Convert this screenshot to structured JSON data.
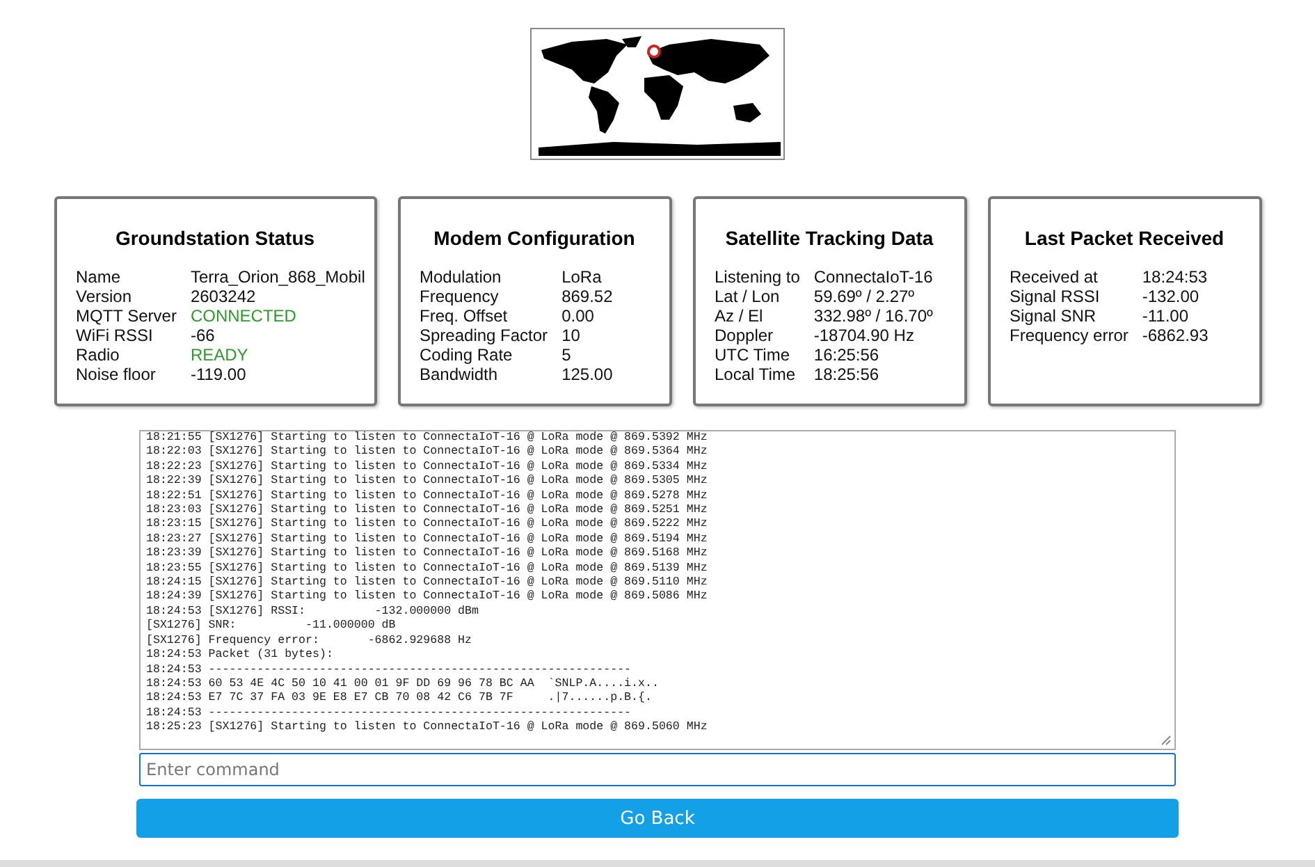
{
  "cards": [
    {
      "title": "Groundstation Status",
      "rows": [
        {
          "label": "Name",
          "value": "Terra_Orion_868_Mobil"
        },
        {
          "label": "Version",
          "value": "2603242"
        },
        {
          "label": "MQTT Server",
          "value": "CONNECTED",
          "color": "#2e9a2e"
        },
        {
          "label": "WiFi RSSI",
          "value": "-66"
        },
        {
          "label": "Radio",
          "value": "READY",
          "color": "#2e9a2e"
        },
        {
          "label": "Noise floor",
          "value": "-119.00"
        }
      ]
    },
    {
      "title": "Modem Configuration",
      "rows": [
        {
          "label": "Modulation",
          "value": "LoRa"
        },
        {
          "label": "Frequency",
          "value": "869.52"
        },
        {
          "label": "Freq. Offset",
          "value": "0.00"
        },
        {
          "label": "Spreading Factor",
          "value": "10"
        },
        {
          "label": "Coding Rate",
          "value": "5"
        },
        {
          "label": "Bandwidth",
          "value": "125.00"
        }
      ]
    },
    {
      "title": "Satellite Tracking Data",
      "rows": [
        {
          "label": "Listening to",
          "value": "ConnectaIoT-16"
        },
        {
          "label": "Lat / Lon",
          "value": "59.69º / 2.27º"
        },
        {
          "label": "Az / El",
          "value": "332.98º / 16.70º"
        },
        {
          "label": "Doppler",
          "value": "-18704.90 Hz"
        },
        {
          "label": "UTC Time",
          "value": "16:25:56"
        },
        {
          "label": "Local Time",
          "value": "18:25:56"
        }
      ]
    },
    {
      "title": "Last Packet Received",
      "rows": [
        {
          "label": "Received at",
          "value": "18:24:53"
        },
        {
          "label": "Signal RSSI",
          "value": "-132.00"
        },
        {
          "label": "Signal SNR",
          "value": "-11.00"
        },
        {
          "label": "Frequency error",
          "value": "-6862.93"
        }
      ]
    }
  ],
  "console": {
    "lines": [
      "18:21:55 [SX1276] Starting to listen to ConnectaIoT-16 @ LoRa mode @ 869.5392 MHz",
      "18:22:03 [SX1276] Starting to listen to ConnectaIoT-16 @ LoRa mode @ 869.5364 MHz",
      "18:22:23 [SX1276] Starting to listen to ConnectaIoT-16 @ LoRa mode @ 869.5334 MHz",
      "18:22:39 [SX1276] Starting to listen to ConnectaIoT-16 @ LoRa mode @ 869.5305 MHz",
      "18:22:51 [SX1276] Starting to listen to ConnectaIoT-16 @ LoRa mode @ 869.5278 MHz",
      "18:23:03 [SX1276] Starting to listen to ConnectaIoT-16 @ LoRa mode @ 869.5251 MHz",
      "18:23:15 [SX1276] Starting to listen to ConnectaIoT-16 @ LoRa mode @ 869.5222 MHz",
      "18:23:27 [SX1276] Starting to listen to ConnectaIoT-16 @ LoRa mode @ 869.5194 MHz",
      "18:23:39 [SX1276] Starting to listen to ConnectaIoT-16 @ LoRa mode @ 869.5168 MHz",
      "18:23:55 [SX1276] Starting to listen to ConnectaIoT-16 @ LoRa mode @ 869.5139 MHz",
      "18:24:15 [SX1276] Starting to listen to ConnectaIoT-16 @ LoRa mode @ 869.5110 MHz",
      "18:24:39 [SX1276] Starting to listen to ConnectaIoT-16 @ LoRa mode @ 869.5086 MHz",
      "18:24:53 [SX1276] RSSI:          -132.000000 dBm",
      "[SX1276] SNR:          -11.000000 dB",
      "[SX1276] Frequency error:       -6862.929688 Hz",
      "18:24:53 Packet (31 bytes):",
      "18:24:53 -------------------------------------------------------------",
      "18:24:53 60 53 4E 4C 50 10 41 00 01 9F DD 69 96 78 BC AA  `SNLP.A....i.x..",
      "18:24:53 E7 7C 37 FA 03 9E E8 E7 CB 70 08 42 C6 7B 7F     .|7......p.B.{.",
      "18:24:53 -------------------------------------------------------------",
      "18:25:23 [SX1276] Starting to listen to ConnectaIoT-16 @ LoRa mode @ 869.5060 MHz"
    ]
  },
  "command": {
    "placeholder": "Enter command"
  },
  "back_button": "Go Back"
}
